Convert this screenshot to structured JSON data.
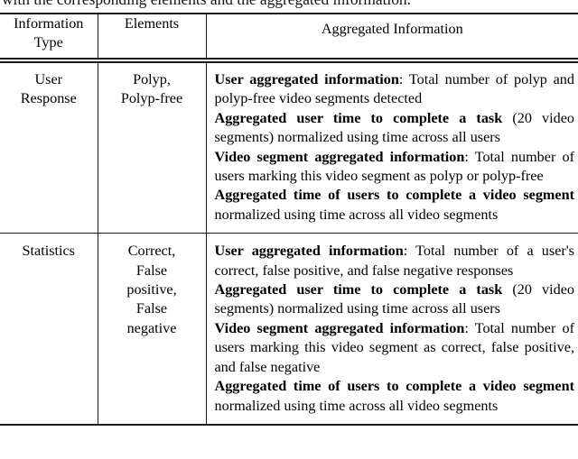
{
  "caption": {
    "truncated_line": "with the corresponding elements and the aggregated information."
  },
  "table": {
    "headers": [
      "Information Type",
      "Elements",
      "Aggregated Information"
    ],
    "header_lines": {
      "col1_line1": "Information",
      "col1_line2": "Type",
      "col2_line1": "Elements",
      "col3_line1": "Aggregated Information"
    },
    "rows": [
      {
        "information_type": "User Response",
        "information_type_lines": [
          "User",
          "Response"
        ],
        "elements": "Polyp, Polyp-free",
        "elements_lines": [
          "Polyp,",
          "Polyp-free"
        ],
        "aggregated_information": [
          {
            "lead": "User aggregated information",
            "rest": ": Total number of polyp and polyp-free video segments detected"
          },
          {
            "lead": "Aggregated user time to complete a task",
            "rest": " (20 video segments) normalized using time across all users"
          },
          {
            "lead": "Video segment aggregated information",
            "rest": ": Total number of users marking this video segment as polyp or polyp-free"
          },
          {
            "lead": "Aggregated time of users to complete a video segment",
            "rest": " normalized using time across all video segments"
          }
        ]
      },
      {
        "information_type": "Statistics",
        "information_type_lines": [
          "Statistics"
        ],
        "elements": "Correct, False positive, False negative",
        "elements_lines": [
          "Correct,",
          "False",
          "positive,",
          "False",
          "negative"
        ],
        "aggregated_information": [
          {
            "lead": "User aggregated information",
            "rest": ":  Total number of a user's correct, false positive, and false negative responses"
          },
          {
            "lead": "Aggregated user time to complete a task",
            "rest": " (20 video segments) normalized using time across all users"
          },
          {
            "lead": "Video segment aggregated information",
            "rest": ": Total number of users marking this video segment as correct, false positive, and false negative"
          },
          {
            "lead": "Aggregated time of users to complete a video segment",
            "rest": " normalized using time across all video segments"
          }
        ]
      }
    ]
  },
  "style": {
    "rule_color": "#1a1a1a",
    "text_color": "#000000",
    "background": "#ffffff"
  }
}
